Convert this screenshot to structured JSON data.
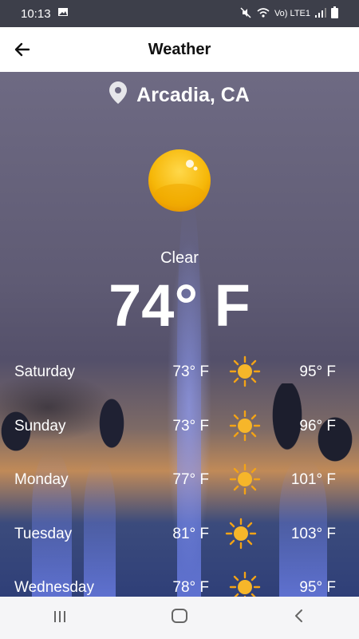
{
  "status_bar": {
    "time": "10:13",
    "network": "Vo) LTE1"
  },
  "app_bar": {
    "title": "Weather"
  },
  "location": "Arcadia, CA",
  "current": {
    "condition": "Clear",
    "temperature": "74° F"
  },
  "forecast": [
    {
      "day": "Saturday",
      "low": "73° F",
      "high": "95° F",
      "icon": "sun-icon"
    },
    {
      "day": "Sunday",
      "low": "73° F",
      "high": "96° F",
      "icon": "sun-icon"
    },
    {
      "day": "Monday",
      "low": "77° F",
      "high": "101° F",
      "icon": "sun-icon"
    },
    {
      "day": "Tuesday",
      "low": "81° F",
      "high": "103° F",
      "icon": "sun-icon"
    },
    {
      "day": "Wednesday",
      "low": "78° F",
      "high": "95° F",
      "icon": "sun-icon"
    }
  ],
  "colors": {
    "app_bar": "#ffffff",
    "status_bar": "#3d3f4a",
    "sun": "#f5b400"
  }
}
